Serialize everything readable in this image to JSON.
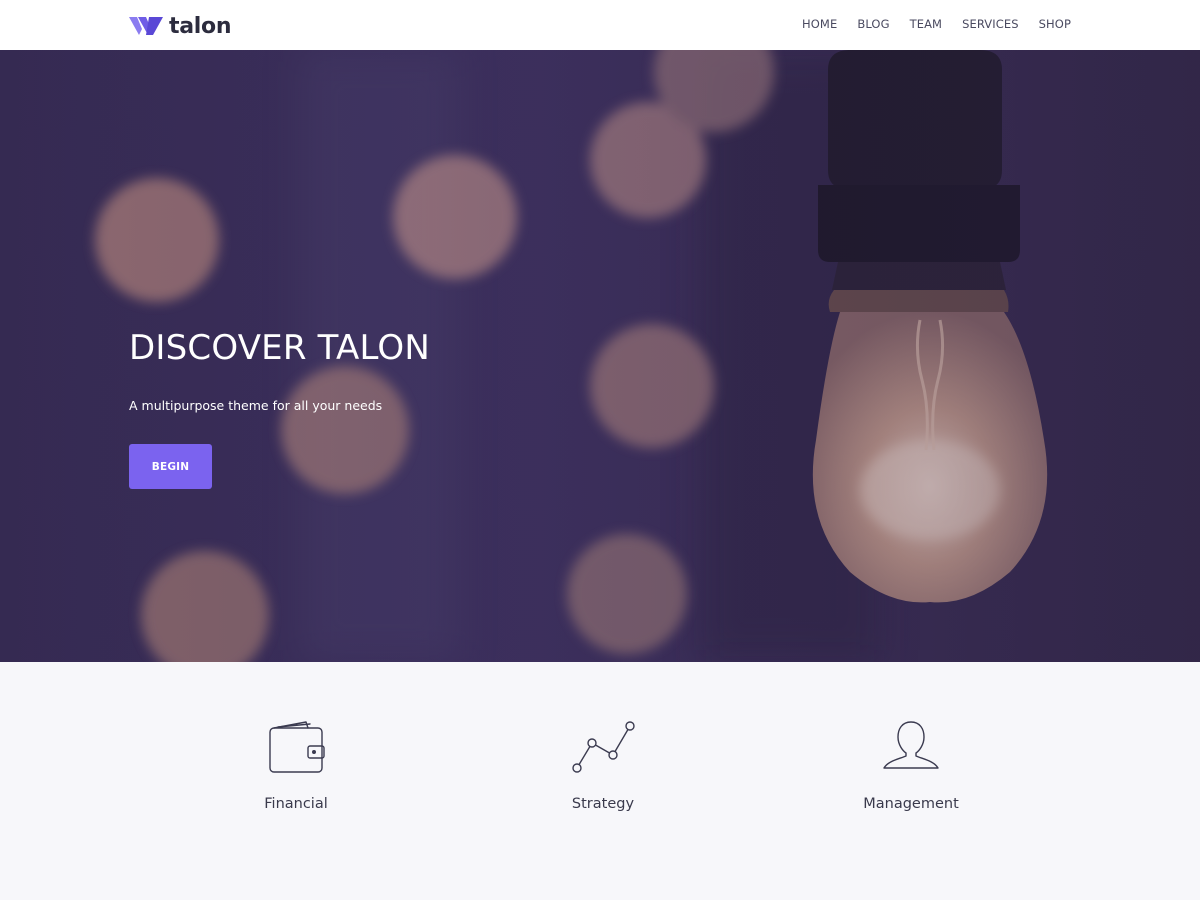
{
  "header": {
    "logo_text": "talon",
    "nav": [
      "HOME",
      "BLOG",
      "TEAM",
      "SERVICES",
      "SHOP"
    ]
  },
  "hero": {
    "title": "DISCOVER TALON",
    "subtitle": "A multipurpose theme for all your needs",
    "button_label": "BEGIN"
  },
  "features": [
    {
      "label": "Financial",
      "icon": "wallet-icon"
    },
    {
      "label": "Strategy",
      "icon": "line-chart-icon"
    },
    {
      "label": "Management",
      "icon": "user-icon"
    }
  ],
  "colors": {
    "accent": "#7b63ef",
    "hero_overlay": "#3b2e5a",
    "features_bg": "#f7f7fa"
  }
}
